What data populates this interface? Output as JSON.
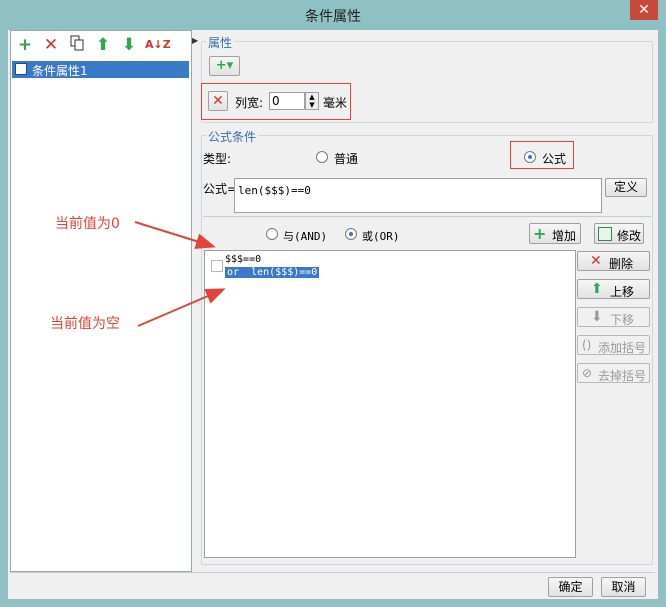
{
  "window": {
    "title": "条件属性",
    "close_glyph": "✕"
  },
  "left_panel": {
    "toolbar_icons": [
      "add-icon",
      "delete-icon",
      "copy-icon",
      "move-up-icon",
      "move-down-icon",
      "sort-icon"
    ],
    "tree_items": [
      {
        "label": "条件属性1"
      }
    ]
  },
  "property_group": {
    "title": "属性",
    "add_glyph": "+▾",
    "column_width_label": "列宽:",
    "column_width_value": "0",
    "unit": "毫米"
  },
  "formula_group": {
    "title": "公式条件",
    "type_label": "类型:",
    "type_options": [
      "普通",
      "公式"
    ],
    "type_selected": "公式",
    "formula_label": "公式=",
    "formula_value": "len($$$)==0",
    "define_button": "定义",
    "logic_options": [
      "与(AND)",
      "或(OR)"
    ],
    "logic_selected": "或(OR)",
    "add_button": "增加",
    "modify_button": "修改",
    "conditions": [
      "$$$==0",
      "or  len($$$)==0"
    ],
    "side_buttons": [
      {
        "label": "删除",
        "enabled": true
      },
      {
        "label": "上移",
        "enabled": true
      },
      {
        "label": "下移",
        "enabled": false
      },
      {
        "label": "添加括号",
        "enabled": false
      },
      {
        "label": "去掉括号",
        "enabled": false
      }
    ]
  },
  "annotations": [
    "当前值为0",
    "当前值为空"
  ],
  "footer": {
    "ok": "确定",
    "cancel": "取消"
  },
  "colors": {
    "accent": "#3a78c8",
    "annotation": "#e0443a",
    "titlebar": "#8fc1c4"
  }
}
